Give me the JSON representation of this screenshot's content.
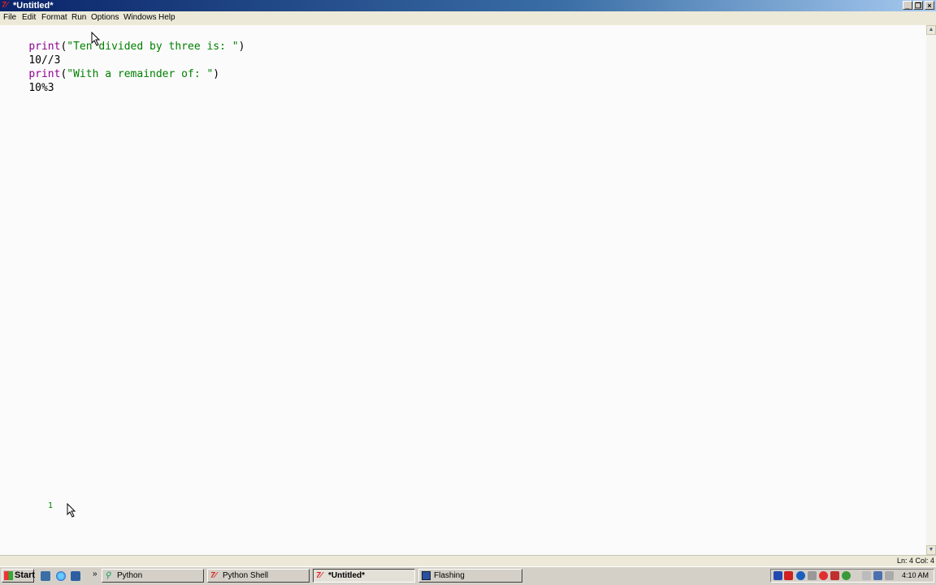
{
  "window": {
    "title": "*Untitled*"
  },
  "menu": [
    "File",
    "Edit",
    "Format",
    "Run",
    "Options",
    "Windows",
    "Help"
  ],
  "editor": {
    "lines": [
      {
        "segments": [
          {
            "text": "print",
            "kind": "kw"
          },
          {
            "text": "(",
            "kind": "plain"
          },
          {
            "text": "\"Ten divided by three is: \"",
            "kind": "str"
          },
          {
            "text": ")",
            "kind": "plain"
          }
        ]
      },
      {
        "segments": [
          {
            "text": "10//3",
            "kind": "plain"
          }
        ]
      },
      {
        "segments": [
          {
            "text": "print",
            "kind": "kw"
          },
          {
            "text": "(",
            "kind": "plain"
          },
          {
            "text": "\"With a remainder of: \"",
            "kind": "str"
          },
          {
            "text": ")",
            "kind": "plain"
          }
        ]
      },
      {
        "segments": [
          {
            "text": "10%3",
            "kind": "plain"
          }
        ]
      }
    ],
    "stray_glyph": "1"
  },
  "status": {
    "position": "Ln: 4 Col: 4"
  },
  "taskbar": {
    "start_label": "Start",
    "tasks": [
      {
        "label": "Python",
        "icon": "python-icon",
        "active": false
      },
      {
        "label": "Python Shell",
        "icon": "idle-icon",
        "active": false
      },
      {
        "label": "*Untitled*",
        "icon": "idle-icon",
        "active": true
      },
      {
        "label": "Flashing",
        "icon": "window-icon",
        "active": false
      }
    ],
    "clock": "4:10 AM"
  },
  "colors": {
    "keyword": "#900090",
    "string": "#008000",
    "titlebar": "#0a246a"
  }
}
